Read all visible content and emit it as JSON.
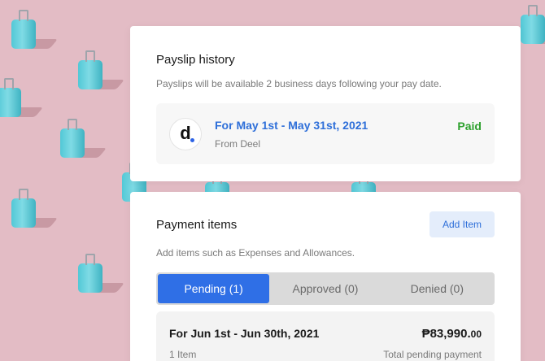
{
  "payslip_history": {
    "title": "Payslip history",
    "subtitle": "Payslips will be available 2 business days following your pay date.",
    "slips": [
      {
        "logo_letter": "d",
        "period": "For May 1st - May 31st, 2021",
        "from": "From Deel",
        "status": "Paid"
      }
    ]
  },
  "payment_items": {
    "title": "Payment items",
    "subtitle": "Add items such as Expenses and Allowances.",
    "add_button": "Add Item",
    "tabs": [
      {
        "label": "Pending (1)",
        "active": true
      },
      {
        "label": "Approved (0)",
        "active": false
      },
      {
        "label": "Denied (0)",
        "active": false
      }
    ],
    "items": [
      {
        "period": "For Jun 1st - Jun 30th, 2021",
        "amount_main": "₱83,990.",
        "amount_cents": "00",
        "count": "1 Item",
        "amount_label": "Total pending payment"
      }
    ]
  },
  "colors": {
    "background": "#e3bcc5",
    "accent_blue": "#2f6fe6",
    "paid_green": "#2ea12e",
    "suitcase_teal": "#52c8d6"
  }
}
